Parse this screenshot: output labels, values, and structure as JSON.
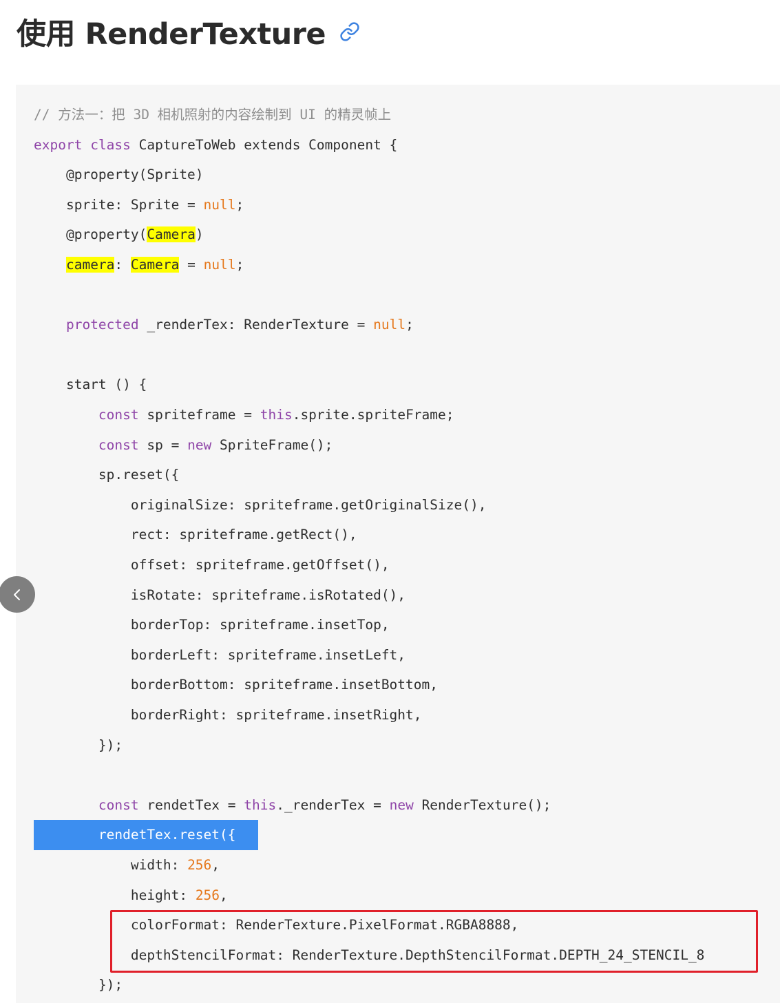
{
  "heading": {
    "title": "使用 RenderTexture",
    "link_icon": "link-icon"
  },
  "nav": {
    "prev_icon": "chevron-left-icon"
  },
  "colors": {
    "keyword": "#8f45a8",
    "literal": "#e5781c",
    "comment": "#8e8e8e",
    "highlight": "#ffff00",
    "selection": "#3c8ef0",
    "annotation_box": "#e0202a"
  },
  "code": {
    "lines": [
      [
        {
          "t": "comment",
          "v": "// 方法一：把 3D 相机照射的内容绘制到 UI 的精灵帧上"
        }
      ],
      [
        {
          "t": "keyword",
          "v": "export"
        },
        {
          "t": "plain",
          "v": " "
        },
        {
          "t": "keyword",
          "v": "class"
        },
        {
          "t": "plain",
          "v": " CaptureToWeb extends Component {"
        }
      ],
      [
        {
          "t": "plain",
          "v": "    @property(Sprite)"
        }
      ],
      [
        {
          "t": "plain",
          "v": "    sprite: Sprite = "
        },
        {
          "t": "literal",
          "v": "null"
        },
        {
          "t": "plain",
          "v": ";"
        }
      ],
      [
        {
          "t": "plain",
          "v": "    @property("
        },
        {
          "t": "hl",
          "v": "Camera"
        },
        {
          "t": "plain",
          "v": ")"
        }
      ],
      [
        {
          "t": "plain",
          "v": "    "
        },
        {
          "t": "hl",
          "v": "camera"
        },
        {
          "t": "plain",
          "v": ": "
        },
        {
          "t": "hl",
          "v": "Camera"
        },
        {
          "t": "plain",
          "v": " = "
        },
        {
          "t": "literal",
          "v": "null"
        },
        {
          "t": "plain",
          "v": ";"
        }
      ],
      [],
      [
        {
          "t": "plain",
          "v": "    "
        },
        {
          "t": "keyword",
          "v": "protected"
        },
        {
          "t": "plain",
          "v": " _renderTex: RenderTexture = "
        },
        {
          "t": "literal",
          "v": "null"
        },
        {
          "t": "plain",
          "v": ";"
        }
      ],
      [],
      [
        {
          "t": "plain",
          "v": "    start () {"
        }
      ],
      [
        {
          "t": "plain",
          "v": "        "
        },
        {
          "t": "keyword",
          "v": "const"
        },
        {
          "t": "plain",
          "v": " spriteframe = "
        },
        {
          "t": "keyword",
          "v": "this"
        },
        {
          "t": "plain",
          "v": ".sprite.spriteFrame;"
        }
      ],
      [
        {
          "t": "plain",
          "v": "        "
        },
        {
          "t": "keyword",
          "v": "const"
        },
        {
          "t": "plain",
          "v": " sp = "
        },
        {
          "t": "keyword",
          "v": "new"
        },
        {
          "t": "plain",
          "v": " SpriteFrame();"
        }
      ],
      [
        {
          "t": "plain",
          "v": "        sp.reset({"
        }
      ],
      [
        {
          "t": "plain",
          "v": "            originalSize: spriteframe.getOriginalSize(),"
        }
      ],
      [
        {
          "t": "plain",
          "v": "            rect: spriteframe.getRect(),"
        }
      ],
      [
        {
          "t": "plain",
          "v": "            offset: spriteframe.getOffset(),"
        }
      ],
      [
        {
          "t": "plain",
          "v": "            isRotate: spriteframe.isRotated(),"
        }
      ],
      [
        {
          "t": "plain",
          "v": "            borderTop: spriteframe.insetTop,"
        }
      ],
      [
        {
          "t": "plain",
          "v": "            borderLeft: spriteframe.insetLeft,"
        }
      ],
      [
        {
          "t": "plain",
          "v": "            borderBottom: spriteframe.insetBottom,"
        }
      ],
      [
        {
          "t": "plain",
          "v": "            borderRight: spriteframe.insetRight,"
        }
      ],
      [
        {
          "t": "plain",
          "v": "        });"
        }
      ],
      [],
      [
        {
          "t": "plain",
          "v": "        "
        },
        {
          "t": "keyword",
          "v": "const"
        },
        {
          "t": "plain",
          "v": " rendetTex = "
        },
        {
          "t": "keyword",
          "v": "this"
        },
        {
          "t": "plain",
          "v": "._renderTex = "
        },
        {
          "t": "keyword",
          "v": "new"
        },
        {
          "t": "plain",
          "v": " RenderTexture();"
        }
      ],
      [
        {
          "t": "plain",
          "v": "        rendetTex.reset({"
        }
      ],
      [
        {
          "t": "plain",
          "v": "            width: "
        },
        {
          "t": "literal",
          "v": "256"
        },
        {
          "t": "plain",
          "v": ","
        }
      ],
      [
        {
          "t": "plain",
          "v": "            height: "
        },
        {
          "t": "literal",
          "v": "256"
        },
        {
          "t": "plain",
          "v": ","
        }
      ],
      [
        {
          "t": "plain",
          "v": "            colorFormat: RenderTexture.PixelFormat.RGBA8888,"
        }
      ],
      [
        {
          "t": "plain",
          "v": "            depthStencilFormat: RenderTexture.DepthStencilFormat.DEPTH_24_STENCIL_8"
        }
      ],
      [
        {
          "t": "plain",
          "v": "        });"
        }
      ]
    ],
    "selected_line": 24,
    "annotated_lines": [
      27,
      28
    ]
  }
}
